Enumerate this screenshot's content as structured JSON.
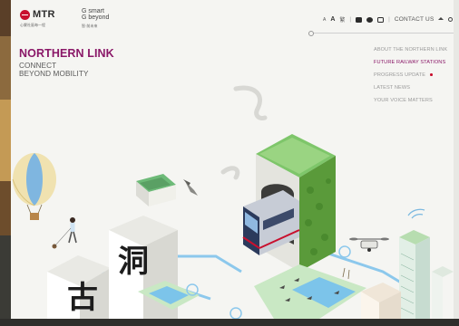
{
  "header": {
    "mtr_logo": "MTR",
    "mtr_tagline": "心繫社區每一程",
    "gosmart_line1": "G smart",
    "gosmart_line2": "G beyond",
    "gosmart_tagline": "智·前未來",
    "utilities": {
      "font_small": "A",
      "font_large": "A",
      "lang": "繁",
      "divider": "|",
      "contact": "CONTACT US"
    }
  },
  "hero": {
    "title": "NORTHERN LINK",
    "subtitle_line1": "CONNECT",
    "subtitle_line2": "BEYOND MOBILITY"
  },
  "nav": {
    "items": [
      {
        "label": "ABOUT THE NORTHERN LINK",
        "active": false
      },
      {
        "label": "FUTURE RAILWAY STATIONS",
        "active": true
      },
      {
        "label": "PROGRESS UPDATE",
        "active": false
      },
      {
        "label": "LATEST NEWS",
        "active": false
      },
      {
        "label": "YOUR VOICE MATTERS",
        "active": false
      }
    ]
  },
  "illustration": {
    "char_1": "古",
    "char_2": "洞"
  },
  "colors": {
    "brand_purple": "#8a1868",
    "mtr_red": "#c8102e",
    "green_wall": "#5a9a3a",
    "water_blue": "#6cc0e6"
  }
}
